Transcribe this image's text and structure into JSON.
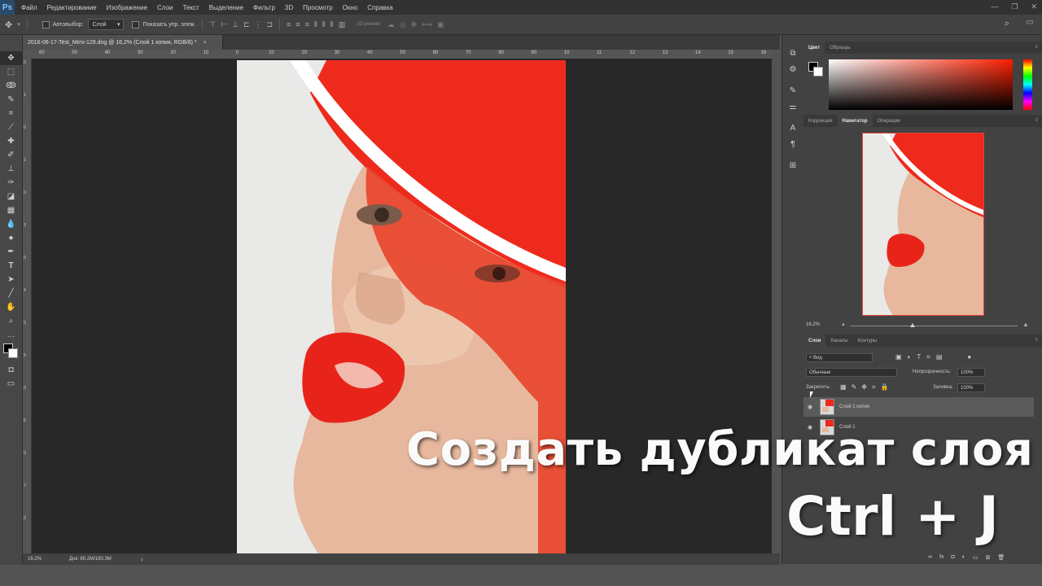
{
  "app": {
    "logo": "Ps",
    "menu": [
      "Файл",
      "Редактирование",
      "Изображение",
      "Слои",
      "Текст",
      "Выделение",
      "Фильтр",
      "3D",
      "Просмотр",
      "Окно",
      "Справка"
    ]
  },
  "options_bar": {
    "autoselect_label": "Автовыбор:",
    "autoselect_value": "Слой",
    "show_controls_label": "Показать упр. элем.",
    "mode_3d_label": "3D-режим:"
  },
  "document": {
    "tab_title": "2016-06-17-Test_Mimi-129.dng @ 16,2% (Слой 1 копия, RGB/8) *",
    "tab_close": "×",
    "ruler_top_ticks": [
      "60",
      "50",
      "40",
      "30",
      "20",
      "10",
      "0",
      "10",
      "20",
      "30",
      "40",
      "50",
      "60",
      "70",
      "80",
      "90",
      "10",
      "11",
      "12",
      "13",
      "14",
      "15",
      "16"
    ],
    "ruler_left_ticks": [
      "0",
      "1",
      "0",
      "2",
      "0",
      "3",
      "0",
      "4",
      "0",
      "5",
      "0",
      "6",
      "0",
      "7",
      "0"
    ],
    "status_zoom": "16,2%",
    "status_doc": "Док: 60,2M/180,3M",
    "status_arrow": "›"
  },
  "panels": {
    "color_tabs": [
      "Цвет",
      "Образцы"
    ],
    "nav_tabs": [
      "Коррекция",
      "Навигатор",
      "Операции"
    ],
    "nav_zoom": "16,2%",
    "layers_tabs": [
      "Слои",
      "Каналы",
      "Контуры"
    ],
    "kind_filter": "Вид",
    "blend_mode": "Обычные",
    "opacity_label": "Непрозрачность:",
    "opacity_value": "100%",
    "lock_label": "Закрепить:",
    "fill_label": "Заливка:",
    "fill_value": "100%",
    "layers": [
      {
        "name": "Слой 1 копия",
        "selected": true
      },
      {
        "name": "Слой 1",
        "selected": false
      }
    ]
  },
  "caption": {
    "line1": "Создать дубликат слоя",
    "line2": "Ctrl + J"
  },
  "colors": {
    "hat_red": "#ee2a1c",
    "accent_border": "#e0443a"
  }
}
